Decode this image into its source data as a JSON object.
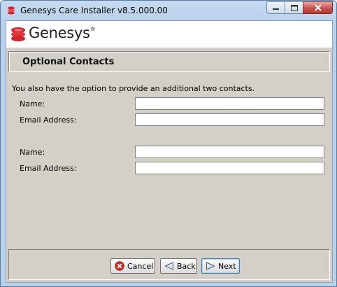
{
  "window": {
    "title": "Genesys Care Installer v8.5.000.00"
  },
  "brand": {
    "name": "Genesys",
    "trademark": "®"
  },
  "page": {
    "title": "Optional Contacts",
    "intro": "You also have the option to provide an additional two contacts."
  },
  "contacts": [
    {
      "name_label": "Name:",
      "email_label": "Email Address:",
      "name_value": "",
      "email_value": ""
    },
    {
      "name_label": "Name:",
      "email_label": "Email Address:",
      "name_value": "",
      "email_value": ""
    }
  ],
  "buttons": {
    "cancel": "Cancel",
    "back": "Back",
    "next": "Next"
  },
  "colors": {
    "brand_red": "#d2232a",
    "close_red": "#c75050",
    "panel_gray": "#d4d0c8"
  }
}
